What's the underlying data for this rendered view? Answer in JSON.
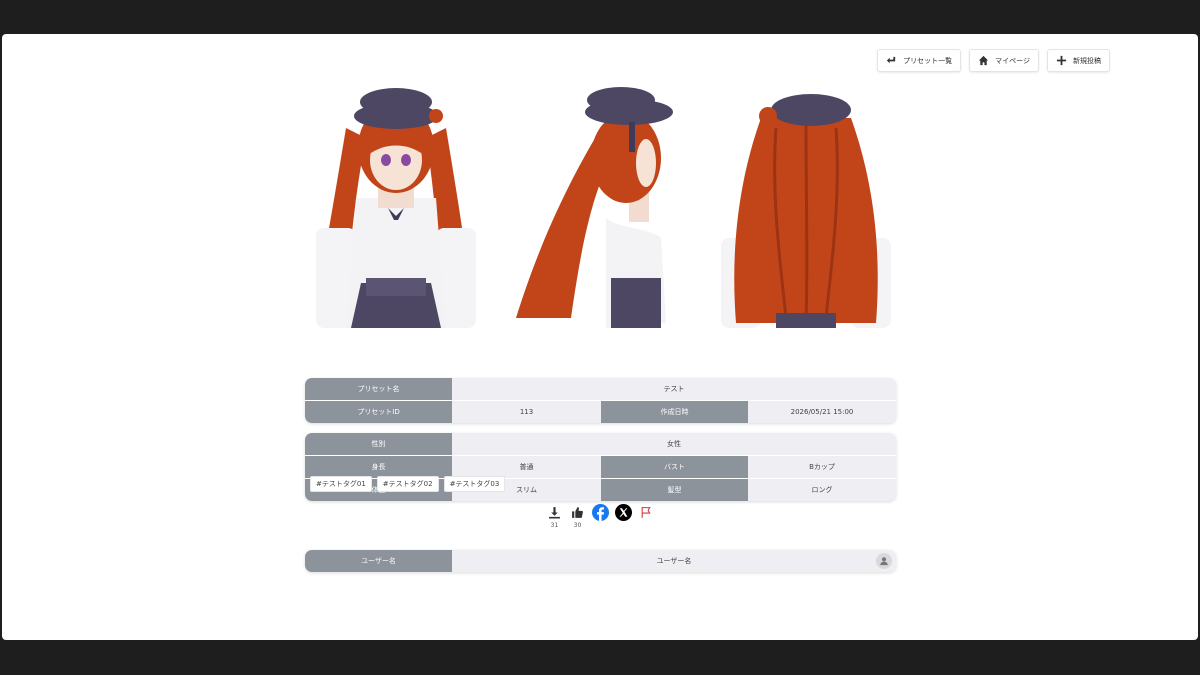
{
  "nav": {
    "buttons": [
      {
        "label": "プリセット一覧",
        "icon": "return-arrow-icon"
      },
      {
        "label": "マイページ",
        "icon": "home-icon"
      },
      {
        "label": "新規投稿",
        "icon": "plus-icon"
      }
    ]
  },
  "preset": {
    "name_label": "プリセット名",
    "name": "テスト",
    "id_label": "プリセットID",
    "id": "113",
    "created_label": "作成日時",
    "created": "2026/05/21 15:00"
  },
  "attrs": {
    "gender_label": "性別",
    "gender": "女性",
    "height_label": "身長",
    "height": "普通",
    "bust_label": "バスト",
    "bust": "Bカップ",
    "body_label": "体型",
    "body": "スリム",
    "hair_label": "髪型",
    "hair": "ロング"
  },
  "tags": [
    "#テストタグ01",
    "#テストタグ02",
    "#テストタグ03"
  ],
  "actions": {
    "download_count": "31",
    "like_count": "30",
    "icons": [
      "download-icon",
      "thumbs-up-icon",
      "facebook-icon",
      "x-icon",
      "flag-icon"
    ]
  },
  "user": {
    "label": "ユーザー名",
    "name": "ユーザー名"
  },
  "colors": {
    "header_cell": "#8c939b",
    "value_cell": "#efeff3",
    "hair": "#c2451a",
    "hat": "#4d4763",
    "facebook": "#1877f2",
    "flag": "#d23b3b"
  }
}
